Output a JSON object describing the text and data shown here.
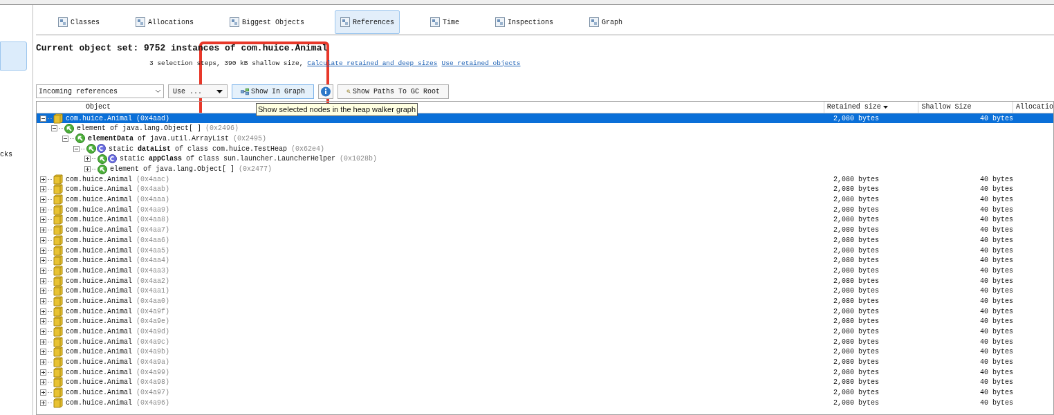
{
  "sidebar": {
    "label": "cks"
  },
  "tabs": [
    {
      "label": "Classes",
      "selected": false
    },
    {
      "label": "Allocations",
      "selected": false
    },
    {
      "label": "Biggest Objects",
      "selected": false
    },
    {
      "label": "References",
      "selected": true
    },
    {
      "label": "Time",
      "selected": false
    },
    {
      "label": "Inspections",
      "selected": false
    },
    {
      "label": "Graph",
      "selected": false
    }
  ],
  "heading": "Current object set: 9752 instances of com.huice.Animal",
  "summary": "3 selection steps, 390 kB shallow size,",
  "links": [
    "Calculate retained and deep sizes",
    "Use retained objects"
  ],
  "toolbar": {
    "mode": "Incoming references",
    "use_button": "Use ...",
    "show_graph": "Show In Graph",
    "paths_button": "Show Paths To GC Root"
  },
  "tooltip": "Show selected nodes in the heap walker graph",
  "table": {
    "columns": [
      "Object",
      "Retained size",
      "Shallow Size",
      "Allocatio"
    ],
    "rows": [
      {
        "kind": "instance",
        "text": "com.huice.Animal",
        "address": "(0x4aad)",
        "retained": "2,080 bytes",
        "shallow": "40 bytes",
        "selected": true,
        "expanded": true,
        "children": [
          {
            "kind": "ref",
            "text": "element of java.lang.Object[ ]",
            "address": "(0x2496)",
            "expanded": true,
            "children": [
              {
                "kind": "ref",
                "text": "**elementData** of java.util.ArrayList",
                "address": "(0x2495)",
                "expanded": true,
                "children": [
                  {
                    "kind": "ref_class",
                    "text": "static **dataList** of class com.huice.TestHeap",
                    "address": "(0x62e4)",
                    "expanded": true,
                    "children": [
                      {
                        "kind": "ref_class",
                        "text": "static **appClass** of class sun.launcher.LauncherHelper",
                        "address": "(0x1028b)",
                        "expanded": false
                      },
                      {
                        "kind": "ref",
                        "text": "element of java.lang.Object[ ]",
                        "address": "(0x2477)",
                        "expanded": false
                      }
                    ]
                  }
                ]
              }
            ]
          }
        ]
      },
      {
        "kind": "instance",
        "text": "com.huice.Animal",
        "address": "(0x4aac)",
        "retained": "2,080 bytes",
        "shallow": "40 bytes",
        "selected": false,
        "expanded": false
      },
      {
        "kind": "instance",
        "text": "com.huice.Animal",
        "address": "(0x4aab)",
        "retained": "2,080 bytes",
        "shallow": "40 bytes",
        "selected": false,
        "expanded": false
      },
      {
        "kind": "instance",
        "text": "com.huice.Animal",
        "address": "(0x4aaa)",
        "retained": "2,080 bytes",
        "shallow": "40 bytes",
        "selected": false,
        "expanded": false
      },
      {
        "kind": "instance",
        "text": "com.huice.Animal",
        "address": "(0x4aa9)",
        "retained": "2,080 bytes",
        "shallow": "40 bytes",
        "selected": false,
        "expanded": false
      },
      {
        "kind": "instance",
        "text": "com.huice.Animal",
        "address": "(0x4aa8)",
        "retained": "2,080 bytes",
        "shallow": "40 bytes",
        "selected": false,
        "expanded": false
      },
      {
        "kind": "instance",
        "text": "com.huice.Animal",
        "address": "(0x4aa7)",
        "retained": "2,080 bytes",
        "shallow": "40 bytes",
        "selected": false,
        "expanded": false
      },
      {
        "kind": "instance",
        "text": "com.huice.Animal",
        "address": "(0x4aa6)",
        "retained": "2,080 bytes",
        "shallow": "40 bytes",
        "selected": false,
        "expanded": false
      },
      {
        "kind": "instance",
        "text": "com.huice.Animal",
        "address": "(0x4aa5)",
        "retained": "2,080 bytes",
        "shallow": "40 bytes",
        "selected": false,
        "expanded": false
      },
      {
        "kind": "instance",
        "text": "com.huice.Animal",
        "address": "(0x4aa4)",
        "retained": "2,080 bytes",
        "shallow": "40 bytes",
        "selected": false,
        "expanded": false
      },
      {
        "kind": "instance",
        "text": "com.huice.Animal",
        "address": "(0x4aa3)",
        "retained": "2,080 bytes",
        "shallow": "40 bytes",
        "selected": false,
        "expanded": false
      },
      {
        "kind": "instance",
        "text": "com.huice.Animal",
        "address": "(0x4aa2)",
        "retained": "2,080 bytes",
        "shallow": "40 bytes",
        "selected": false,
        "expanded": false
      },
      {
        "kind": "instance",
        "text": "com.huice.Animal",
        "address": "(0x4aa1)",
        "retained": "2,080 bytes",
        "shallow": "40 bytes",
        "selected": false,
        "expanded": false
      },
      {
        "kind": "instance",
        "text": "com.huice.Animal",
        "address": "(0x4aa0)",
        "retained": "2,080 bytes",
        "shallow": "40 bytes",
        "selected": false,
        "expanded": false
      },
      {
        "kind": "instance",
        "text": "com.huice.Animal",
        "address": "(0x4a9f)",
        "retained": "2,080 bytes",
        "shallow": "40 bytes",
        "selected": false,
        "expanded": false
      },
      {
        "kind": "instance",
        "text": "com.huice.Animal",
        "address": "(0x4a9e)",
        "retained": "2,080 bytes",
        "shallow": "40 bytes",
        "selected": false,
        "expanded": false
      },
      {
        "kind": "instance",
        "text": "com.huice.Animal",
        "address": "(0x4a9d)",
        "retained": "2,080 bytes",
        "shallow": "40 bytes",
        "selected": false,
        "expanded": false
      },
      {
        "kind": "instance",
        "text": "com.huice.Animal",
        "address": "(0x4a9c)",
        "retained": "2,080 bytes",
        "shallow": "40 bytes",
        "selected": false,
        "expanded": false
      },
      {
        "kind": "instance",
        "text": "com.huice.Animal",
        "address": "(0x4a9b)",
        "retained": "2,080 bytes",
        "shallow": "40 bytes",
        "selected": false,
        "expanded": false
      },
      {
        "kind": "instance",
        "text": "com.huice.Animal",
        "address": "(0x4a9a)",
        "retained": "2,080 bytes",
        "shallow": "40 bytes",
        "selected": false,
        "expanded": false
      },
      {
        "kind": "instance",
        "text": "com.huice.Animal",
        "address": "(0x4a99)",
        "retained": "2,080 bytes",
        "shallow": "40 bytes",
        "selected": false,
        "expanded": false
      },
      {
        "kind": "instance",
        "text": "com.huice.Animal",
        "address": "(0x4a98)",
        "retained": "2,080 bytes",
        "shallow": "40 bytes",
        "selected": false,
        "expanded": false
      },
      {
        "kind": "instance",
        "text": "com.huice.Animal",
        "address": "(0x4a97)",
        "retained": "2,080 bytes",
        "shallow": "40 bytes",
        "selected": false,
        "expanded": false
      },
      {
        "kind": "instance",
        "text": "com.huice.Animal",
        "address": "(0x4a96)",
        "retained": "2,080 bytes",
        "shallow": "40 bytes",
        "selected": false,
        "expanded": false
      }
    ]
  }
}
